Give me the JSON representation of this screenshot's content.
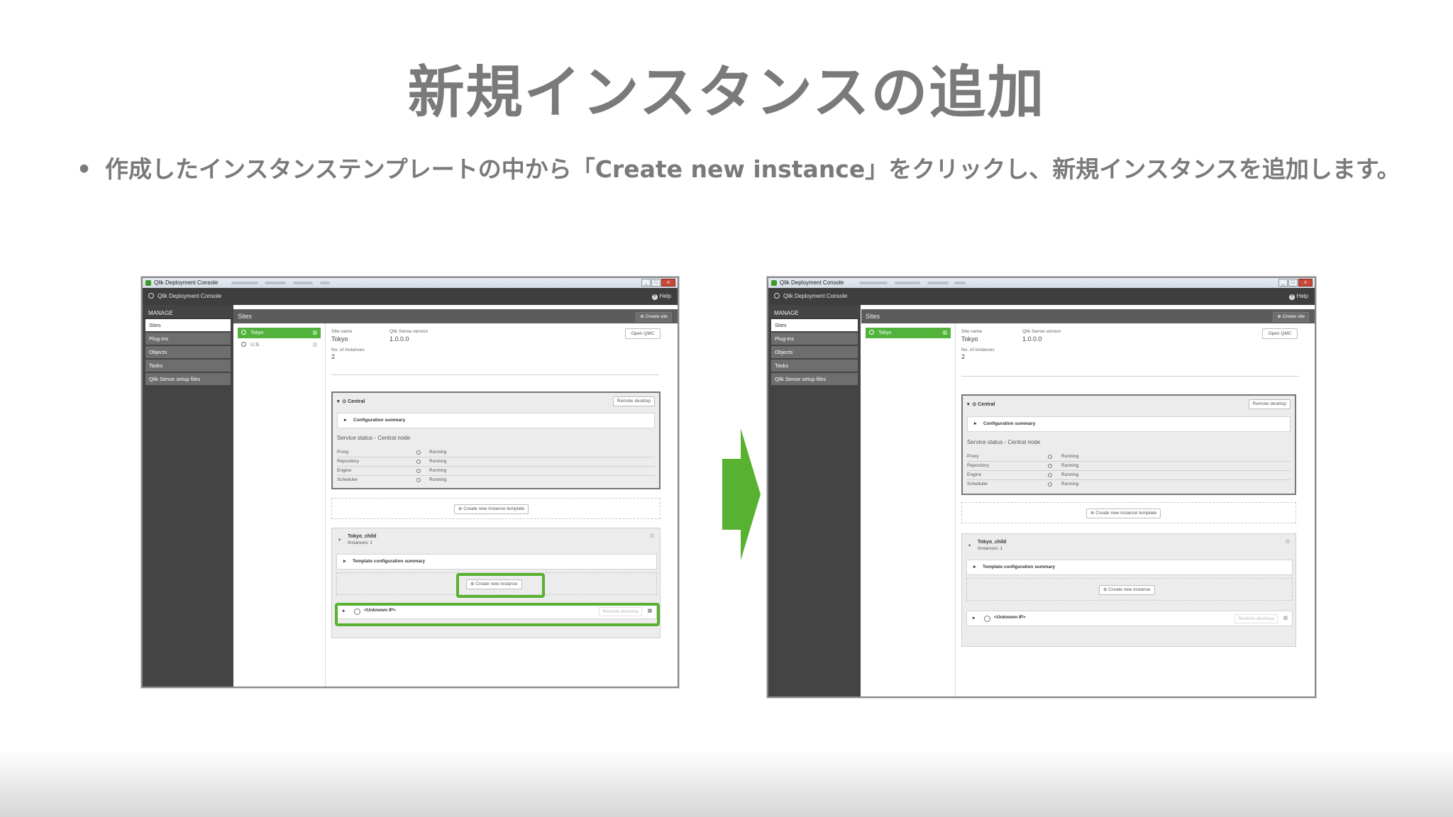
{
  "slide": {
    "title": "新規インスタンスの追加",
    "bullet": "•",
    "text": "作成したインスタンステンプレートの中から「Create new instance」をクリックし、新規インスタンスを追加します。"
  },
  "colors": {
    "accent": "#58b130",
    "title": "#7a7a7a",
    "sidebar": "#444444"
  },
  "window": {
    "titlebar": "Qlik Deployment Console",
    "win_buttons": [
      "_",
      "□",
      "x"
    ],
    "app_title": "Qlik Deployment Console",
    "help": "Help",
    "manage": "MANAGE",
    "nav": [
      "Sites",
      "Plug-ins",
      "Objects",
      "Tasks",
      "Qlik Sense setup files"
    ],
    "sites_header": "Sites",
    "create_site": "Create site",
    "sites_before": [
      "Tokyo",
      "U.S."
    ],
    "sites_after": [
      "Tokyo"
    ],
    "site_name_label": "Site name",
    "site_name": "Tokyo",
    "version_label": "Qlik Sense version",
    "version": "1.0.0.0",
    "instances_label": "No. of instances",
    "instances": "2",
    "open_qmc": "Open QMC",
    "central": "Central",
    "remote_desktop": "Remote desktop",
    "config_summary": "Configuration summary",
    "service_status": "Service status - Central node",
    "services": [
      {
        "name": "Proxy",
        "status": "Running"
      },
      {
        "name": "Repository",
        "status": "Running"
      },
      {
        "name": "Engine",
        "status": "Running"
      },
      {
        "name": "Scheduler",
        "status": "Running"
      }
    ],
    "create_template": "Create new instance template",
    "template_name": "Tokyo_child",
    "template_instances": "Instances: 1",
    "template_config": "Template configuration summary",
    "create_instance": "Create new instance",
    "unknown_ip": "<Unknown IP>"
  }
}
